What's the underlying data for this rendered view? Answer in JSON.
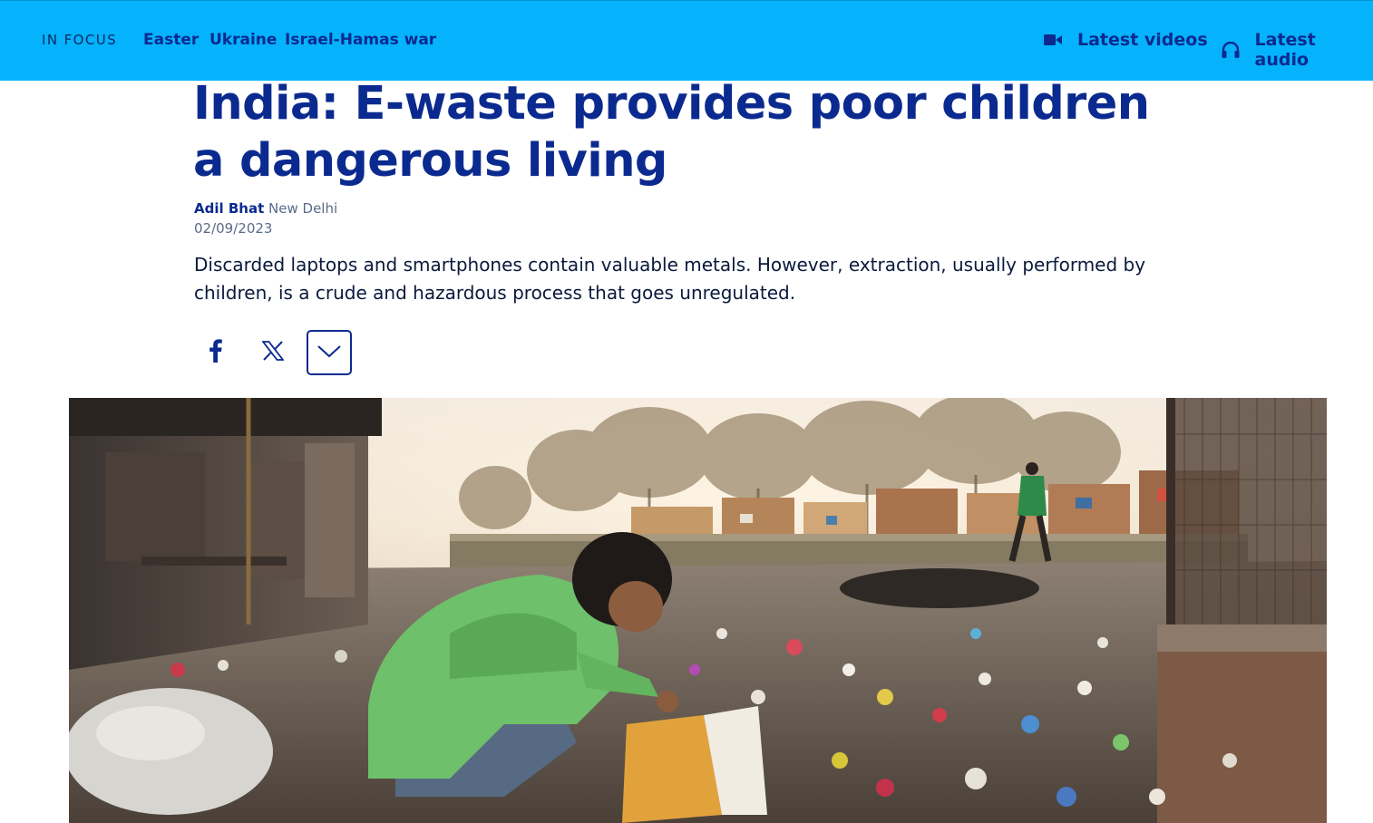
{
  "topbar": {
    "focus_label": "IN FOCUS",
    "focus_links": [
      "Easter",
      "Ukraine",
      "Israel-Hamas war"
    ],
    "latest_videos": "Latest videos",
    "latest_audio": "Latest audio",
    "background_color": "#05b2fc",
    "link_color": "#0b2a8f",
    "videos_icon": "video-camera-icon",
    "audio_icon": "headphones-icon"
  },
  "article": {
    "headline": "India: E-waste provides poor children a dangerous living",
    "author": "Adil Bhat",
    "location": "New Delhi",
    "date": "02/09/2023",
    "lede": "Discarded laptops and smartphones contain valuable metals. However, extraction, usually performed by children, is a crude and hazardous process that goes unregulated."
  },
  "share": {
    "icons": [
      "facebook-icon",
      "x-icon",
      "chevron-down-icon"
    ]
  }
}
